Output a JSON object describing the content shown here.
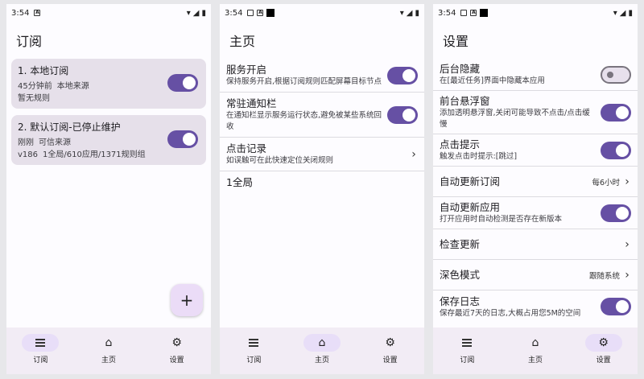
{
  "phones": [
    {
      "status": {
        "time": "3:54"
      },
      "title": "订阅",
      "subscriptions": [
        {
          "name": "1. 本地订阅",
          "time": "45分钟前",
          "source": "本地来源",
          "detail": "暂无规则"
        },
        {
          "name": "2. 默认订阅-已停止维护",
          "time": "刚刚",
          "source": "可信来源",
          "version": "v186",
          "detail": "1全局/610应用/1371规则组"
        }
      ],
      "fab": "+"
    },
    {
      "status": {
        "time": "3:54"
      },
      "title": "主页",
      "rows": [
        {
          "title": "服务开启",
          "desc": "保持服务开启,根据订阅规则匹配屏幕目标节点"
        },
        {
          "title": "常驻通知栏",
          "desc": "在通知栏显示服务运行状态,避免被某些系统回收"
        },
        {
          "title": "点击记录",
          "desc": "如误触可在此快速定位关闭规则"
        }
      ],
      "footer_text": "1全局"
    },
    {
      "status": {
        "time": "3:54"
      },
      "title": "设置",
      "rows": [
        {
          "title": "后台隐藏",
          "desc": "在[最近任务]界面中隐藏本应用"
        },
        {
          "title": "前台悬浮窗",
          "desc": "添加透明悬浮窗,关闭可能导致不点击/点击缓慢"
        },
        {
          "title": "点击提示",
          "desc": "触发点击时提示:[跳过]"
        },
        {
          "title": "自动更新订阅",
          "value": "每6小时"
        },
        {
          "title": "自动更新应用",
          "desc": "打开应用时自动检测是否存在新版本"
        },
        {
          "title": "检查更新"
        },
        {
          "title": "深色模式",
          "value": "跟随系统"
        },
        {
          "title": "保存日志",
          "desc": "保存最近7天的日志,大概占用您5M的空间"
        }
      ]
    }
  ],
  "nav": {
    "subscriptions": "订阅",
    "home": "主页",
    "settings": "设置"
  },
  "colors": {
    "accent": "#6650a4",
    "card": "#e6e0ea",
    "nav_bg": "#f2ecf5"
  }
}
